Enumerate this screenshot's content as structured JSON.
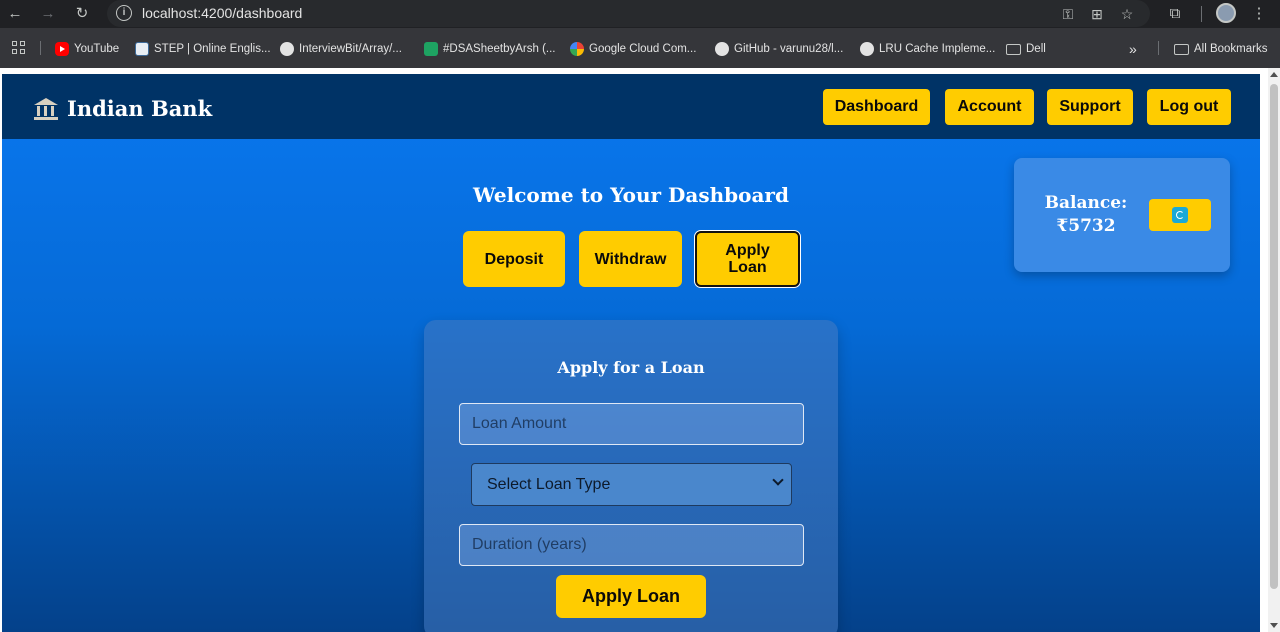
{
  "browser": {
    "url": "localhost:4200/dashboard",
    "bookmarks": [
      {
        "label": "YouTube",
        "icon": "youtube-icon"
      },
      {
        "label": "STEP | Online Englis...",
        "icon": "step-icon"
      },
      {
        "label": "InterviewBit/Array/...",
        "icon": "github-icon"
      },
      {
        "label": "#DSASheetbyArsh (...",
        "icon": "sheets-icon"
      },
      {
        "label": "Google Cloud Com...",
        "icon": "google-cloud-icon"
      },
      {
        "label": "GitHub - varunu28/l...",
        "icon": "github-icon"
      },
      {
        "label": "LRU Cache Impleme...",
        "icon": "globe-icon"
      },
      {
        "label": "Dell",
        "icon": "folder-icon"
      }
    ],
    "overflow_label": "»",
    "all_bookmarks_label": "All Bookmarks"
  },
  "navbar": {
    "brand": "Indian Bank",
    "links": [
      "Dashboard",
      "Account",
      "Support",
      "Log out"
    ]
  },
  "dashboard": {
    "welcome": "Welcome to Your Dashboard",
    "actions": [
      {
        "label": "Deposit",
        "active": false
      },
      {
        "label": "Withdraw",
        "active": false
      },
      {
        "label": "Apply Loan",
        "active": true
      }
    ]
  },
  "balance": {
    "label": "Balance:",
    "amount": "₹5732"
  },
  "loan_form": {
    "title": "Apply for a Loan",
    "amount_placeholder": "Loan Amount",
    "type_selected": "Select Loan Type",
    "duration_placeholder": "Duration (years)",
    "submit_label": "Apply Loan"
  },
  "colors": {
    "navbar": "#003366",
    "accent": "#ffcc00",
    "background_top": "#0a78f0",
    "background_bottom": "#04418a"
  }
}
